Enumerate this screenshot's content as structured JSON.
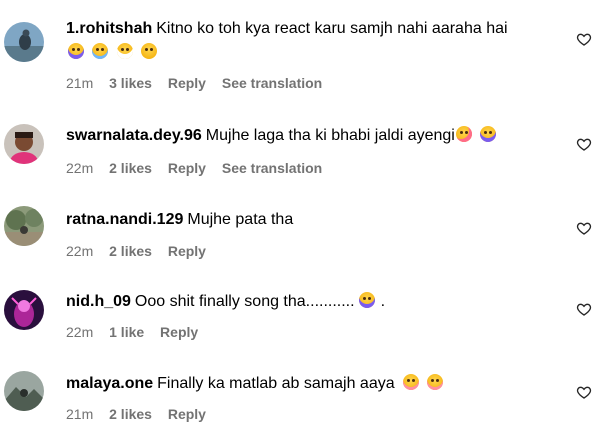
{
  "comments": [
    {
      "username": "1.rohitshah",
      "text": "Kitno ko toh kya react karu samjh nahi aaraha hai",
      "emojis": [
        "crying-face",
        "joy-face",
        "grinning-face",
        "smiling-face"
      ],
      "time": "21m",
      "likes": "3 likes",
      "reply": "Reply",
      "translation": "See translation"
    },
    {
      "username": "swarnalata.dey.96",
      "text": "Mujhe laga tha ki bhabi jaldi ayengi",
      "emojis": [
        "yum-face",
        "crying-face"
      ],
      "time": "22m",
      "likes": "2 likes",
      "reply": "Reply",
      "translation": "See translation"
    },
    {
      "username": "ratna.nandi.129",
      "text": "Mujhe pata tha",
      "emojis": [],
      "time": "22m",
      "likes": "2 likes",
      "reply": "Reply"
    },
    {
      "username": "nid.h_09",
      "text": "Ooo shit finally song tha...........",
      "emojis": [
        "crying-face"
      ],
      "text_suffix": ".",
      "time": "22m",
      "likes": "1 like",
      "reply": "Reply"
    },
    {
      "username": "malaya.one",
      "text": "Finally ka matlab ab samajh aaya",
      "emojis": [
        "sad-face",
        "sad-face"
      ],
      "time": "21m",
      "likes": "2 likes",
      "reply": "Reply"
    }
  ],
  "colors": {
    "text": "#000000",
    "meta": "#737373",
    "background": "#ffffff"
  }
}
